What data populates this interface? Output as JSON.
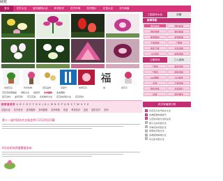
{
  "header": {
    "site_name": "网花"
  },
  "nav": {
    "items": [
      "首页",
      "花卉大全",
      "室内植物大全",
      "养花知识",
      "花卉市场",
      "花卉图片",
      "花语大全",
      "花卉病害",
      "多肉植物"
    ]
  },
  "grid": {
    "row1_captions": [
      "",
      "",
      "",
      ""
    ],
    "row2_captions": [
      "",
      "",
      "",
      ""
    ]
  },
  "icons": {
    "captions": [
      "鼠鼠花朵",
      "风水植物",
      "鼠花品种",
      "富贵竹",
      "吉祥花卉",
      "福",
      "鼠花卉"
    ]
  },
  "link_rows": [
    [
      "赏花天机再揭秘",
      "绿植大全",
      "鼠尾草",
      "多肉植物",
      "多肉萌物"
    ],
    [
      "园艺资材",
      "盆景赏析",
      "花艺花语",
      "论坛精华大全",
      "花卉的养殖大全",
      "花卉药材",
      "中药材",
      "新花卉资讯"
    ]
  ],
  "alphabet": {
    "label": "按拼音排序",
    "letters": "A B C D E F G H J K L M N O P Q R S T W X Y Z"
  },
  "category_links": [
    "花语大全",
    "花卉资讯",
    "室内植物",
    "多肉植物",
    "花卉种植",
    "花语",
    "养花知识",
    "盆景",
    "园艺花卉",
    "多肉"
  ],
  "articles": [
    {
      "title": "第十一届中国花卉交易会将于2月29日开幕"
    },
    {
      "title": "9月份如何养殖繁殖多肉"
    }
  ],
  "sidebar": {
    "tabs": [
      "三国游戏大全",
      "攻略"
    ],
    "box1": {
      "title": "新闻导航",
      "rows": [
        [
          "国内新闻",
          "国际新闻"
        ],
        [
          "财经频道",
          "娱乐新闻"
        ],
        [
          "体育新闻",
          "军事新闻"
        ],
        [
          "下载游戏",
          "三国杀"
        ],
        [
          "电影下载",
          "手机游戏"
        ],
        [
          "QQ游戏",
          "网页游戏"
        ]
      ]
    },
    "box2": {
      "title": "主题游戏",
      "tabs": [
        "主题游戏",
        "三人游戏"
      ],
      "rows": [
        [
          "三国杀",
          "单机游戏"
        ],
        [
          "三国志",
          "网页游戏"
        ],
        [
          "ppt模板",
          "QQ游戏"
        ],
        [
          "手游",
          "下载游戏"
        ],
        [
          "梦幻西游",
          "手游排行"
        ],
        [
          "问道",
          "倚天屠龙"
        ]
      ]
    },
    "rank": {
      "title": "花卉养殖排行榜",
      "items": [
        "养花花卉资讯信息大全",
        "多肉植物种植技巧",
        "兰花的养殖方法和注意",
        "君子兰的养殖方法",
        "月季花的养殖方法",
        "绿萝的养殖方法",
        "多肉植物种类大全",
        "吊兰的养殖方法"
      ]
    }
  },
  "colors": {
    "accent": "#d8347a",
    "accent_dark": "#b01d5f",
    "pale": "#fbe0ec"
  }
}
